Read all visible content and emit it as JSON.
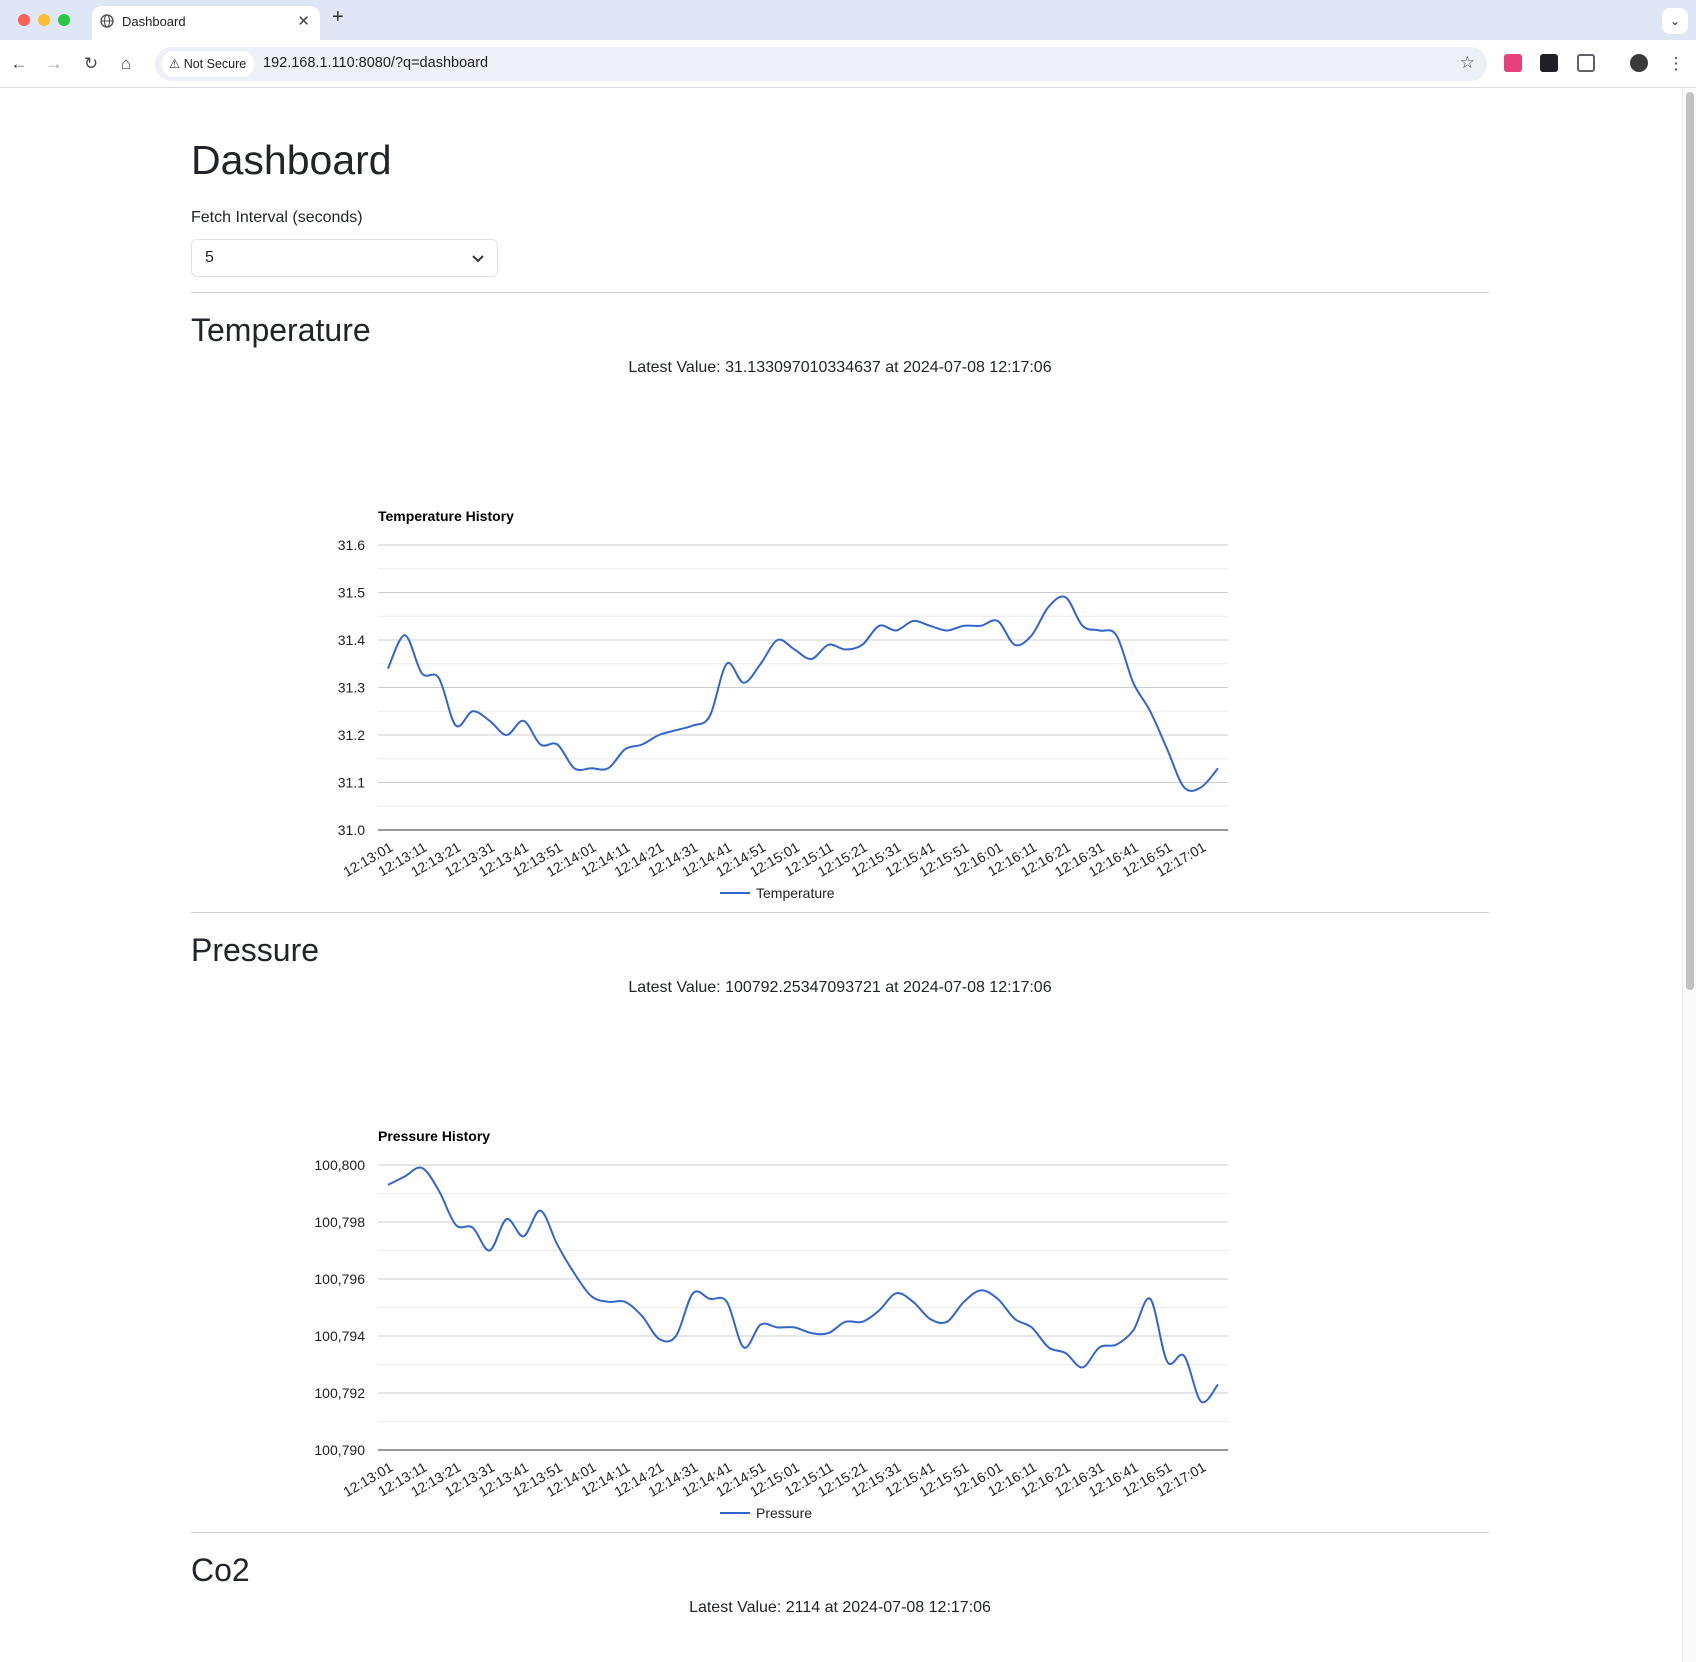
{
  "browser": {
    "tab_title": "Dashboard",
    "security_label": "Not Secure",
    "url": "192.168.1.110:8080/?q=dashboard"
  },
  "page": {
    "title": "Dashboard",
    "fetch_label": "Fetch Interval (seconds)",
    "fetch_value": "5"
  },
  "sections": [
    {
      "title": "Temperature",
      "latest_text": "Latest Value: 31.133097010334637 at 2024-07-08 12:17:06",
      "chart_title": "Temperature History",
      "legend": "Temperature"
    },
    {
      "title": "Pressure",
      "latest_text": "Latest Value: 100792.25347093721 at 2024-07-08 12:17:06",
      "chart_title": "Pressure History",
      "legend": "Pressure"
    },
    {
      "title": "Co2",
      "latest_text": "Latest Value: 2114 at 2024-07-08 12:17:06"
    }
  ],
  "chart_data": [
    {
      "type": "line",
      "title": "Temperature History",
      "series_color": "#3366cc",
      "ylim": [
        31.0,
        31.6
      ],
      "yticks": [
        "31.0",
        "31.1",
        "31.2",
        "31.3",
        "31.4",
        "31.5",
        "31.6"
      ],
      "ytick_values": [
        31.0,
        31.1,
        31.2,
        31.3,
        31.4,
        31.5,
        31.6
      ],
      "xtick_labels": [
        "12:13:01",
        "12:13:11",
        "12:13:21",
        "12:13:31",
        "12:13:41",
        "12:13:51",
        "12:14:01",
        "12:14:11",
        "12:14:21",
        "12:14:31",
        "12:14:41",
        "12:14:51",
        "12:15:01",
        "12:15:11",
        "12:15:21",
        "12:15:31",
        "12:15:41",
        "12:15:51",
        "12:16:01",
        "12:16:11",
        "12:16:21",
        "12:16:31",
        "12:16:41",
        "12:16:51",
        "12:17:01"
      ],
      "series": [
        {
          "name": "Temperature",
          "values": [
            31.34,
            31.41,
            31.33,
            31.32,
            31.22,
            31.25,
            31.23,
            31.2,
            31.23,
            31.18,
            31.18,
            31.13,
            31.13,
            31.13,
            31.17,
            31.18,
            31.2,
            31.21,
            31.22,
            31.24,
            31.35,
            31.31,
            31.35,
            31.4,
            31.38,
            31.36,
            31.39,
            31.38,
            31.39,
            31.43,
            31.42,
            31.44,
            31.43,
            31.42,
            31.43,
            31.43,
            31.44,
            31.39,
            31.41,
            31.47,
            31.49,
            31.43,
            31.42,
            31.41,
            31.31,
            31.25,
            31.17,
            31.09,
            31.09,
            31.13
          ]
        }
      ]
    },
    {
      "type": "line",
      "title": "Pressure History",
      "series_color": "#3366cc",
      "ylim": [
        100790,
        100800
      ],
      "yticks": [
        "100,790",
        "100,792",
        "100,794",
        "100,796",
        "100,798",
        "100,800"
      ],
      "ytick_values": [
        100790,
        100792,
        100794,
        100796,
        100798,
        100800
      ],
      "xtick_labels": [
        "12:13:01",
        "12:13:11",
        "12:13:21",
        "12:13:31",
        "12:13:41",
        "12:13:51",
        "12:14:01",
        "12:14:11",
        "12:14:21",
        "12:14:31",
        "12:14:41",
        "12:14:51",
        "12:15:01",
        "12:15:11",
        "12:15:21",
        "12:15:31",
        "12:15:41",
        "12:15:51",
        "12:16:01",
        "12:16:11",
        "12:16:21",
        "12:16:31",
        "12:16:41",
        "12:16:51",
        "12:17:01"
      ],
      "series": [
        {
          "name": "Pressure",
          "values": [
            100799.3,
            100799.6,
            100799.9,
            100799.1,
            100797.9,
            100797.8,
            100797.0,
            100798.1,
            100797.5,
            100798.4,
            100797.2,
            100796.2,
            100795.4,
            100795.2,
            100795.2,
            100794.7,
            100793.9,
            100794.0,
            100795.5,
            100795.3,
            100795.2,
            100793.6,
            100794.4,
            100794.3,
            100794.3,
            100794.1,
            100794.1,
            100794.5,
            100794.5,
            100794.9,
            100795.5,
            100795.2,
            100794.6,
            100794.5,
            100795.2,
            100795.6,
            100795.3,
            100794.6,
            100794.3,
            100793.6,
            100793.4,
            100792.9,
            100793.6,
            100793.7,
            100794.2,
            100795.3,
            100793.1,
            100793.3,
            100791.7,
            100792.3
          ]
        }
      ]
    }
  ]
}
